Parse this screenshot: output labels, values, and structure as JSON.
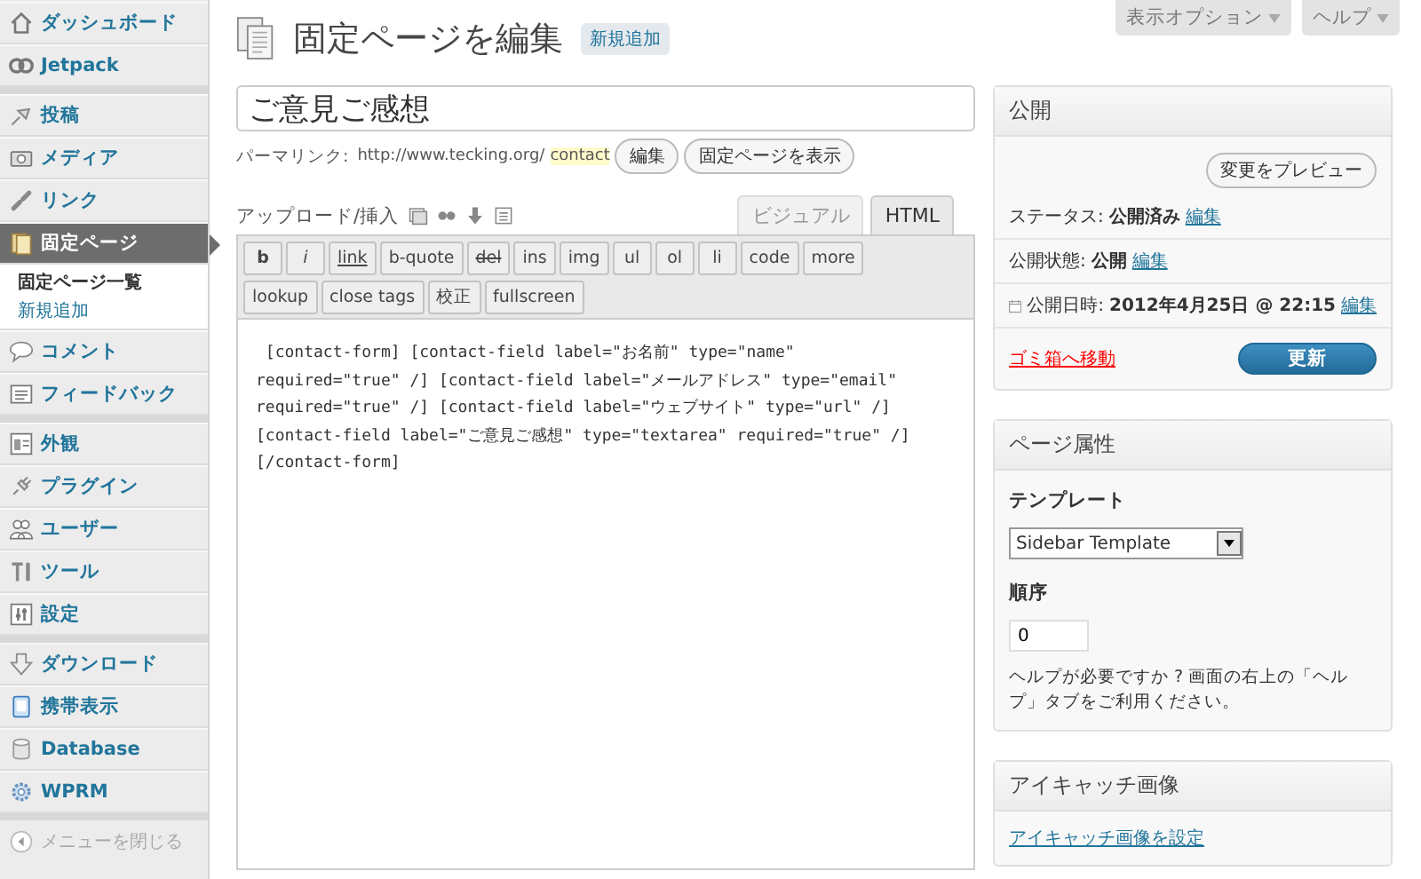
{
  "sidebar": {
    "groups": [
      {
        "items": [
          {
            "label": "ダッシュボード",
            "selected": false
          },
          {
            "label": "Jetpack",
            "selected": false
          }
        ]
      },
      {
        "items": [
          {
            "label": "投稿",
            "selected": false
          },
          {
            "label": "メディア",
            "selected": false
          },
          {
            "label": "リンク",
            "selected": false
          },
          {
            "label": "固定ページ",
            "selected": true,
            "children": [
              {
                "label": "固定ページ一覧",
                "selected": true
              },
              {
                "label": "新規追加",
                "selected": false
              }
            ]
          },
          {
            "label": "コメント",
            "selected": false
          },
          {
            "label": "フィードバック",
            "selected": false
          }
        ]
      },
      {
        "items": [
          {
            "label": "外観",
            "selected": false
          },
          {
            "label": "プラグイン",
            "selected": false
          },
          {
            "label": "ユーザー",
            "selected": false
          },
          {
            "label": "ツール",
            "selected": false
          },
          {
            "label": "設定",
            "selected": false
          }
        ]
      },
      {
        "items": [
          {
            "label": "ダウンロード",
            "selected": false
          },
          {
            "label": "携帯表示",
            "selected": false
          },
          {
            "label": "Database",
            "selected": false
          },
          {
            "label": "WPRM",
            "selected": false
          }
        ]
      }
    ],
    "collapse": "メニューを閉じる"
  },
  "screen_tabs": [
    "表示オプション",
    "ヘルプ"
  ],
  "page_title": "固定ページを編集",
  "add_new": "新規追加",
  "title_field": {
    "value": "ご意見ご感想"
  },
  "permalink": {
    "label": "パーマリンク:",
    "url": "http://www.tecking.org/",
    "slug": "contact",
    "buttons": [
      "編集",
      "固定ページを表示"
    ]
  },
  "upload_label": "アップロード/挿入",
  "editor_tabs": [
    {
      "label": "ビジュアル",
      "selected": false
    },
    {
      "label": "HTML",
      "selected": true
    }
  ],
  "quicktags": [
    {
      "label": "b",
      "kind": "bold"
    },
    {
      "label": "i",
      "kind": "italic"
    },
    {
      "label": "link",
      "kind": "underline"
    },
    {
      "label": "b-quote",
      "kind": "plain"
    },
    {
      "label": "del",
      "kind": "strike"
    },
    {
      "label": "ins",
      "kind": "plain"
    },
    {
      "label": "img",
      "kind": "plain"
    },
    {
      "label": "ul",
      "kind": "plain"
    },
    {
      "label": "ol",
      "kind": "plain"
    },
    {
      "label": "li",
      "kind": "plain"
    },
    {
      "label": "code",
      "kind": "plain"
    },
    {
      "label": "more",
      "kind": "plain"
    },
    {
      "label": "lookup",
      "kind": "plain"
    },
    {
      "label": "close tags",
      "kind": "plain"
    },
    {
      "label": "校正",
      "kind": "plain"
    },
    {
      "label": "fullscreen",
      "kind": "plain"
    }
  ],
  "editor_lines": [
    " [contact-form] [contact-field label=\"お名前\" type=\"name\"",
    "required=\"true\" /] [contact-field label=\"メールアドレス\" type=\"email\"",
    "required=\"true\" /] [contact-field label=\"ウェブサイト\" type=\"url\" /]",
    "[contact-field label=\"ご意見ご感想\" type=\"textarea\" required=\"true\" /]",
    "[/contact-form]"
  ],
  "publish_box": {
    "title": "公開",
    "preview_button": "変更をプレビュー",
    "rows": [
      {
        "label": "ステータス:",
        "value": "公開済み",
        "link": "編集"
      },
      {
        "label": "公開状態:",
        "value": "公開",
        "link": "編集"
      },
      {
        "label": "公開日時:",
        "value": "2012年4月25日 @ 22:15",
        "link": "編集"
      }
    ],
    "trash_link": "ゴミ箱へ移動",
    "update_button": "更新"
  },
  "attributes_box": {
    "title": "ページ属性",
    "template_label": "テンプレート",
    "template_value": "Sidebar Template",
    "order_label": "順序",
    "order_value": "0",
    "help": "ヘルプが必要ですか ? 画面の右上の「ヘルプ」タブをご利用ください。"
  },
  "thumbnail_box": {
    "title": "アイキャッチ画像",
    "link": "アイキャッチ画像を設定"
  }
}
